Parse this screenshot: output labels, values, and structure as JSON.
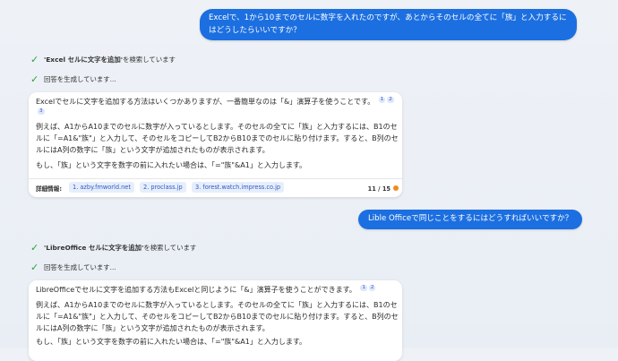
{
  "messages": {
    "user1": "Excelで、1から10までのセルに数字を入れたのですが、あとからそのセルの全てに「族」と入力するにはどうしたらいいですか？",
    "user2": "Lible Officeで同じことをするにはどうすればいいですか？"
  },
  "status1": {
    "search_query": "'Excel セルに文字を追加'",
    "search_suffix": " を検索しています",
    "generating": "回答を生成しています..."
  },
  "answer1": {
    "intro": "Excelでセルに文字を追加する方法はいくつかありますが、一番簡単なのは「&」演算子を使うことです。",
    "citations": [
      "1",
      "2",
      "3"
    ],
    "para1": "例えば、A1からA10までのセルに数字が入っているとします。そのセルの全てに「族」と入力するには、B1のセルに「=A1&\"族\"」と入力して、そのセルをコピーしてB2からB10までのセルに貼り付けます。すると、B列のセルにはA列の数字に「族」という文字が追加されたものが表示されます。",
    "para2": "もし、「族」という文字を数字の前に入れたい場合は、「=\"族\"&A1」と入力します。",
    "footer_label": "詳細情報:",
    "links": [
      "1. azby.fmworld.net",
      "2. proclass.jp",
      "3. forest.watch.impress.co.jp"
    ],
    "counter": "11 / 15"
  },
  "status2": {
    "search_query": "'LibreOffice セルに文字を追加'",
    "search_suffix": " を検索しています",
    "generating": "回答を生成しています..."
  },
  "answer2": {
    "intro": "LibreOfficeでセルに文字を追加する方法もExcelと同じように「&」演算子を使うことができます。",
    "citations": [
      "1",
      "2"
    ],
    "para1": "例えば、A1からA10までのセルに数字が入っているとします。そのセルの全てに「族」と入力するには、B1のセルに「=A1&\"族\"」と入力して、そのセルをコピーしてB2からB10までのセルに貼り付けます。すると、B列のセルにはA列の数字に「族」という文字が追加されたものが表示されます。",
    "para2": "もし、「族」という文字を数字の前に入れたい場合は、「=\"族\"&A1」と入力します。"
  },
  "colors": {
    "user_bubble": "#1c6fe0",
    "check": "#2aa23a",
    "link": "#2b5bc6",
    "counter_dot": "#f08b1c"
  }
}
